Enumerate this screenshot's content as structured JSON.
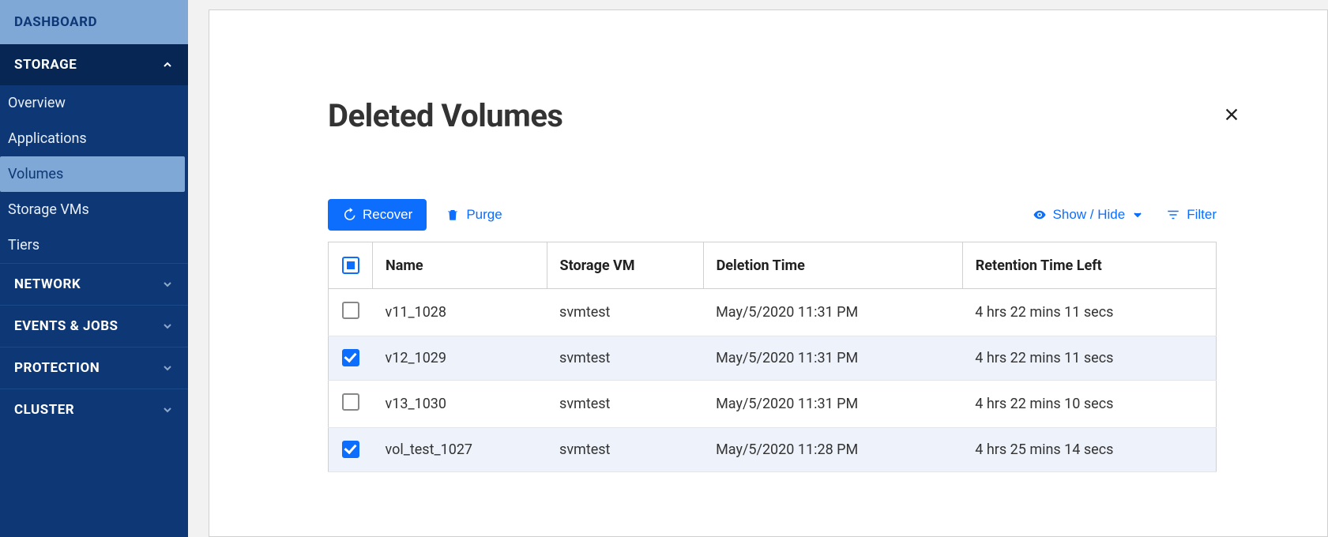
{
  "sidebar": {
    "dashboard": "DASHBOARD",
    "storage": {
      "label": "STORAGE",
      "items": [
        "Overview",
        "Applications",
        "Volumes",
        "Storage VMs",
        "Tiers"
      ],
      "active_index": 2
    },
    "network": "NETWORK",
    "events": "EVENTS & JOBS",
    "protection": "PROTECTION",
    "cluster": "CLUSTER"
  },
  "page": {
    "title": "Deleted Volumes"
  },
  "toolbar": {
    "recover": "Recover",
    "purge": "Purge",
    "show_hide": "Show / Hide",
    "filter": "Filter"
  },
  "table": {
    "headers": {
      "name": "Name",
      "svm": "Storage VM",
      "deleted": "Deletion Time",
      "retention": "Retention Time Left"
    },
    "rows": [
      {
        "selected": false,
        "name": "v11_1028",
        "svm": "svmtest",
        "deleted": "May/5/2020 11:31 PM",
        "retention": "4 hrs 22 mins 11 secs"
      },
      {
        "selected": true,
        "name": "v12_1029",
        "svm": "svmtest",
        "deleted": "May/5/2020 11:31 PM",
        "retention": "4 hrs 22 mins 11 secs"
      },
      {
        "selected": false,
        "name": "v13_1030",
        "svm": "svmtest",
        "deleted": "May/5/2020 11:31 PM",
        "retention": "4 hrs 22 mins 10 secs"
      },
      {
        "selected": true,
        "name": "vol_test_1027",
        "svm": "svmtest",
        "deleted": "May/5/2020 11:28 PM",
        "retention": "4 hrs 25 mins 14 secs"
      }
    ]
  }
}
